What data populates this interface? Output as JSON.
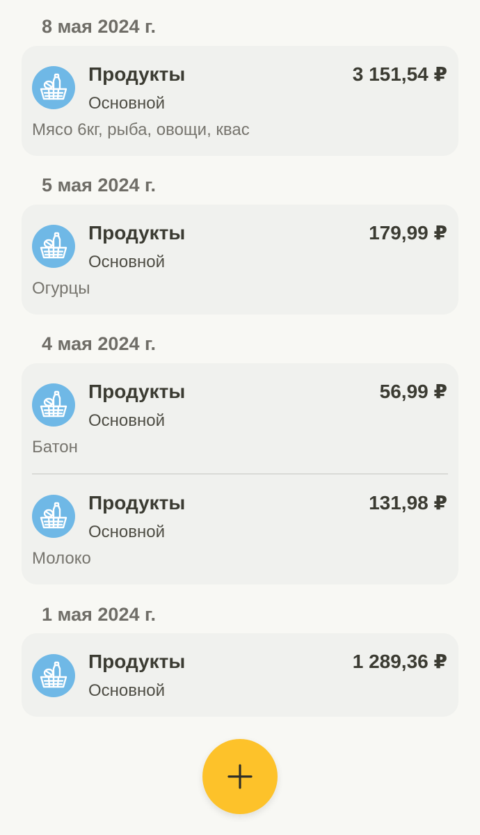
{
  "groups": [
    {
      "date": "8 мая 2024 г.",
      "entries": [
        {
          "category": "Продукты",
          "account": "Основной",
          "note": "Мясо 6кг, рыба, овощи, квас",
          "amount": "3 151,54 ₽",
          "icon": "grocery-basket-icon"
        }
      ]
    },
    {
      "date": "5 мая 2024 г.",
      "entries": [
        {
          "category": "Продукты",
          "account": "Основной",
          "note": "Огурцы",
          "amount": "179,99 ₽",
          "icon": "grocery-basket-icon"
        }
      ]
    },
    {
      "date": "4 мая 2024 г.",
      "entries": [
        {
          "category": "Продукты",
          "account": "Основной",
          "note": "Батон",
          "amount": "56,99 ₽",
          "icon": "grocery-basket-icon"
        },
        {
          "category": "Продукты",
          "account": "Основной",
          "note": "Молоко",
          "amount": "131,98 ₽",
          "icon": "grocery-basket-icon"
        }
      ]
    },
    {
      "date": "1 мая 2024 г.",
      "entries": [
        {
          "category": "Продукты",
          "account": "Основной",
          "note": "",
          "amount": "1 289,36 ₽",
          "icon": "grocery-basket-icon"
        }
      ]
    }
  ],
  "fab": {
    "icon": "plus-icon"
  },
  "colors": {
    "background": "#f8f8f4",
    "card": "#f0f1ee",
    "icon_circle": "#6fb8e6",
    "fab": "#fdc22a"
  }
}
